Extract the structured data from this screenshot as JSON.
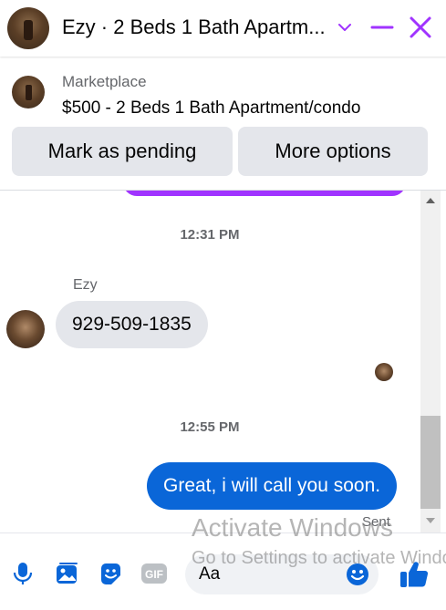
{
  "header": {
    "title": "Ezy · 2 Beds 1 Bath Apartm...",
    "accent_color": "#a033ff"
  },
  "marketplace": {
    "label": "Marketplace",
    "listing": "$500 - 2 Beds 1 Bath Apartment/condo",
    "mark_pending_label": "Mark as pending",
    "more_options_label": "More options"
  },
  "conversation": {
    "timestamp_1": "12:31 PM",
    "sender_name": "Ezy",
    "incoming_message": "929-509-1835",
    "timestamp_2": "12:55 PM",
    "outgoing_message": "Great, i will call you soon.",
    "status": "Sent",
    "outgoing_color": "#0a66d8"
  },
  "composer": {
    "placeholder": "Aa",
    "icons": [
      "microphone-icon",
      "photo-icon",
      "sticker-icon",
      "gif-icon",
      "emoji-icon",
      "like-icon"
    ],
    "gif_label": "GIF"
  },
  "watermark": {
    "line1": "Activate Windows",
    "line2": "Go to Settings to activate Windows."
  }
}
